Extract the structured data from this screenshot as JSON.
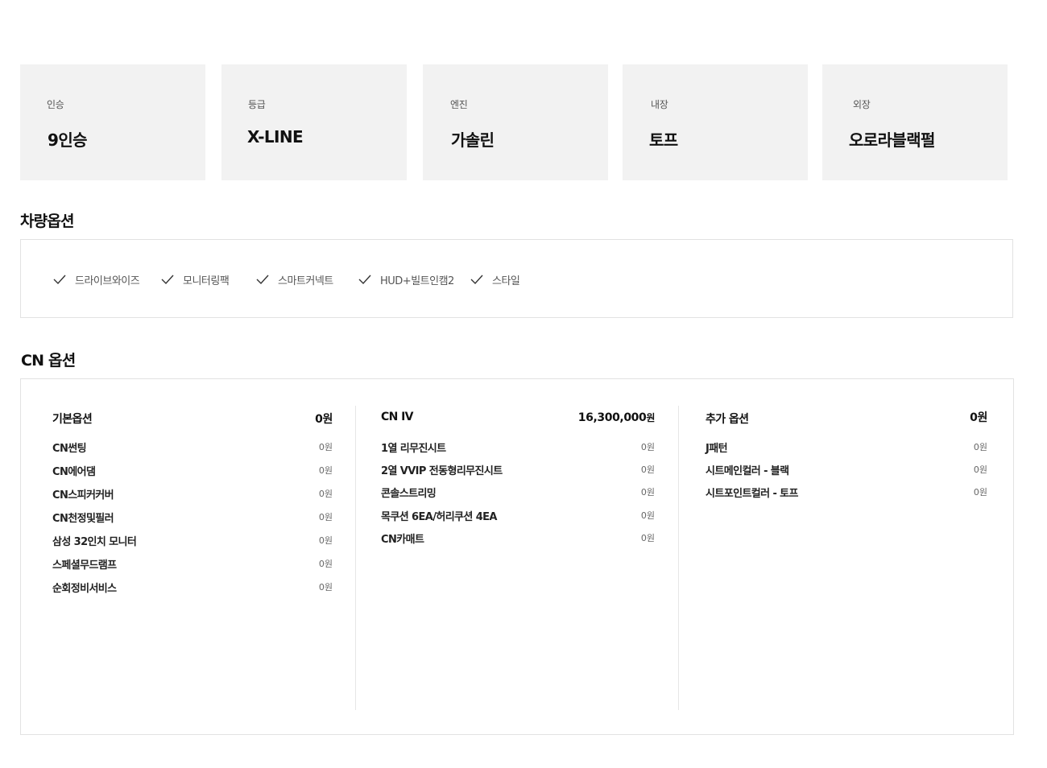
{
  "specs": [
    {
      "label": "인승",
      "value": "9인승"
    },
    {
      "label": "등급",
      "value": "X-LINE"
    },
    {
      "label": "엔진",
      "value": "가솔린"
    },
    {
      "label": "내장",
      "value": "토프"
    },
    {
      "label": "외장",
      "value": "오로라블랙펄"
    }
  ],
  "vehicle_options": {
    "title": "차량옵션",
    "items": [
      {
        "label": "드라이브와이즈",
        "icon": "check-icon"
      },
      {
        "label": "모니터링팩",
        "icon": "check-icon"
      },
      {
        "label": "스마트커넥트",
        "icon": "check-icon"
      },
      {
        "label": "HUD+빌트인캠2",
        "icon": "check-icon"
      },
      {
        "label": "스타일",
        "icon": "check-icon"
      }
    ]
  },
  "cn_options": {
    "title": "CN 옵션",
    "columns": [
      {
        "title": "기본옵션",
        "total": "0원",
        "items": [
          {
            "name": "CN썬팅",
            "price": "0원"
          },
          {
            "name": "CN에어댐",
            "price": "0원"
          },
          {
            "name": "CN스피커커버",
            "price": "0원"
          },
          {
            "name": "CN천정및필러",
            "price": "0원"
          },
          {
            "name": "삼성 32인치 모니터",
            "price": "0원"
          },
          {
            "name": "스페셜무드램프",
            "price": "0원"
          },
          {
            "name": "순회정비서비스",
            "price": "0원"
          }
        ]
      },
      {
        "title": "CN IV",
        "total_amount": "16,300,000",
        "total_unit": "원",
        "items": [
          {
            "name": "1열 리무진시트",
            "price": "0원"
          },
          {
            "name": "2열 VVIP 전동형리무진시트",
            "price": "0원"
          },
          {
            "name": "콘솔스트리밍",
            "price": "0원"
          },
          {
            "name": "목쿠션 6EA/허리쿠션 4EA",
            "price": "0원"
          },
          {
            "name": "CN카매트",
            "price": "0원"
          }
        ]
      },
      {
        "title": "추가 옵션",
        "total": "0원",
        "items": [
          {
            "name": "J패턴",
            "price": "0원"
          },
          {
            "name": "시트메인컬러 - 블랙",
            "price": "0원"
          },
          {
            "name": "시트포인트컬러 - 토프",
            "price": "0원"
          }
        ]
      }
    ]
  }
}
